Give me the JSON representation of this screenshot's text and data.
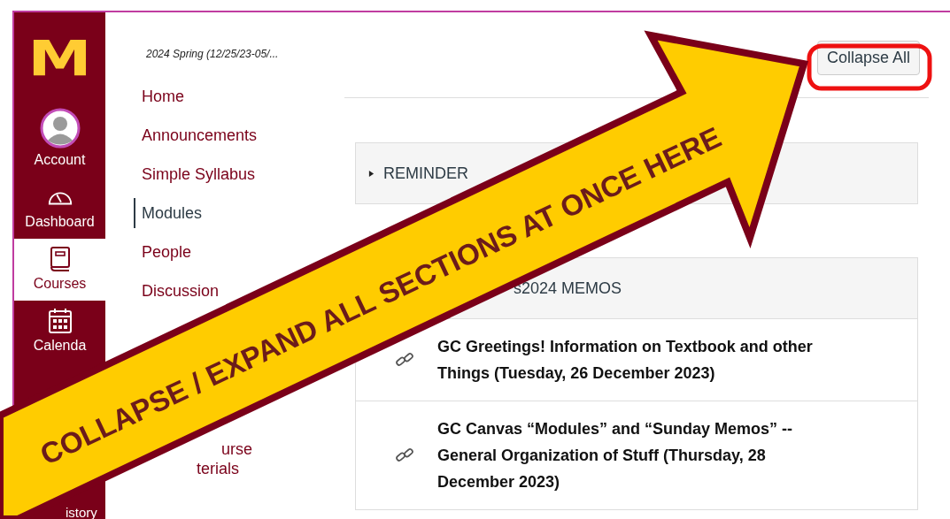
{
  "global_nav": {
    "logo": "M",
    "items": [
      {
        "label": "Account",
        "kind": "avatar",
        "selected": false
      },
      {
        "label": "Dashboard",
        "kind": "gauge",
        "selected": false
      },
      {
        "label": "Courses",
        "kind": "book",
        "selected": true
      },
      {
        "label": "Calenda",
        "kind": "calendar",
        "selected": false
      },
      {
        "label": "istory",
        "kind": "none",
        "selected": false
      }
    ]
  },
  "course_nav": {
    "term": "2024 Spring (12/25/23-05/...",
    "items": [
      {
        "label": "Home",
        "selected": false
      },
      {
        "label": "Announcements",
        "selected": false
      },
      {
        "label": "Simple Syllabus",
        "selected": false
      },
      {
        "label": "Modules",
        "selected": true
      },
      {
        "label": "People",
        "selected": false
      },
      {
        "label": "Discussion",
        "selected": false
      },
      {
        "label": "urse\nterials",
        "selected": false
      }
    ]
  },
  "toolbar": {
    "button": "Collapse All"
  },
  "modules": [
    {
      "title": "REMINDER",
      "expanded": false
    },
    {
      "title": "s2024 MEMOS",
      "expanded": true,
      "items": [
        {
          "title": "GC Greetings! Information on Textbook and other Things (Tuesday, 26 December 2023)"
        },
        {
          "title": "GC Canvas “Modules” and “Sunday Memos” -- General Organization of Stuff (Thursday, 28 December 2023)"
        }
      ]
    }
  ],
  "callout": {
    "text": "COLLAPSE / EXPAND ALL SECTIONS AT ONCE HERE"
  }
}
